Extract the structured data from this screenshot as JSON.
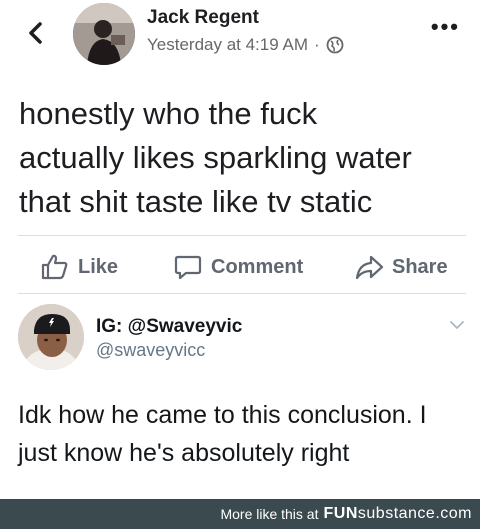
{
  "post": {
    "author": "Jack Regent",
    "timestamp": "Yesterday at 4:19 AM",
    "separator": "·",
    "text": "honestly who the fuck\nactually likes sparkling water\nthat shit taste like tv static",
    "icons": {
      "back": "back-chevron-icon",
      "privacy": "globe-icon",
      "more": "more-dots-icon"
    }
  },
  "actions": {
    "like": "Like",
    "comment": "Comment",
    "share": "Share",
    "icons": {
      "like": "thumbs-up-icon",
      "comment": "comment-bubble-icon",
      "share": "share-arrow-icon"
    }
  },
  "reply": {
    "name": "IG: @Swaveyvic",
    "handle": "@swaveyvicc",
    "text": "Idk how he came to this conclusion. I\njust know he's absolutely right",
    "icons": {
      "menu": "chevron-down-icon"
    }
  },
  "footer": {
    "prefix": "More like this at",
    "brand_fun": "FUN",
    "brand_substance": "substance",
    "domain": ".com"
  },
  "colors": {
    "text_primary": "#1c1e21",
    "text_secondary": "#65676b",
    "action_gray": "#606770",
    "footer_bg": "#3a4a4f"
  }
}
